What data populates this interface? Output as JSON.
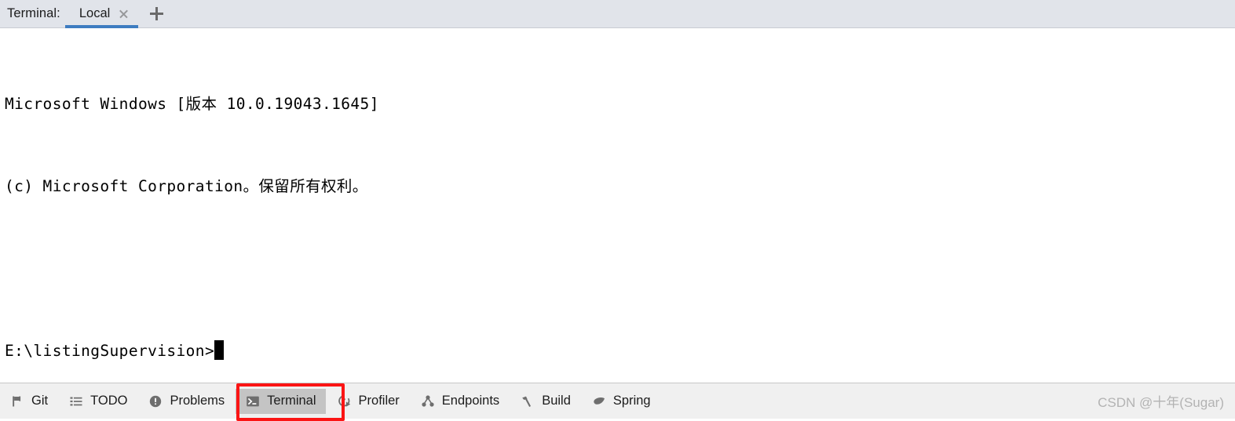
{
  "window": {
    "tool_label": "Terminal:",
    "tabs": [
      {
        "label": "Local",
        "active": true,
        "close_icon": "close-icon"
      }
    ],
    "add_tab_icon": "plus-icon"
  },
  "terminal": {
    "lines": [
      "Microsoft Windows [版本 10.0.19043.1645]",
      "(c) Microsoft Corporation。保留所有权利。",
      "",
      "E:\\listingSupervision>"
    ],
    "prompt": "E:\\listingSupervision>",
    "cursor": "block-cursor",
    "background": "#ffffff",
    "foreground": "#000000"
  },
  "status_bar": {
    "items": [
      {
        "label": "Git",
        "icon": "git-branch-icon",
        "selected": false
      },
      {
        "label": "TODO",
        "icon": "todo-list-icon",
        "selected": false
      },
      {
        "label": "Problems",
        "icon": "problems-info-icon",
        "selected": false
      },
      {
        "label": "Terminal",
        "icon": "terminal-icon",
        "selected": true
      },
      {
        "label": "Profiler",
        "icon": "profiler-icon",
        "selected": false
      },
      {
        "label": "Endpoints",
        "icon": "endpoints-graph-icon",
        "selected": false
      },
      {
        "label": "Build",
        "icon": "build-hammer-icon",
        "selected": false
      },
      {
        "label": "Spring",
        "icon": "spring-leaf-icon",
        "selected": false
      }
    ],
    "watermark": "CSDN @十年(Sugar)"
  },
  "annotation": {
    "target": "Terminal",
    "color": "#fb1414"
  },
  "colors": {
    "tabbar_background": "#e1e4ea",
    "tab_underline": "#3d7cc0",
    "statusbar_background": "#f0f0f0",
    "selected_item_background": "#c4c4c4",
    "annotation_red": "#fb1414",
    "watermark_gray": "#b3b3b3"
  }
}
